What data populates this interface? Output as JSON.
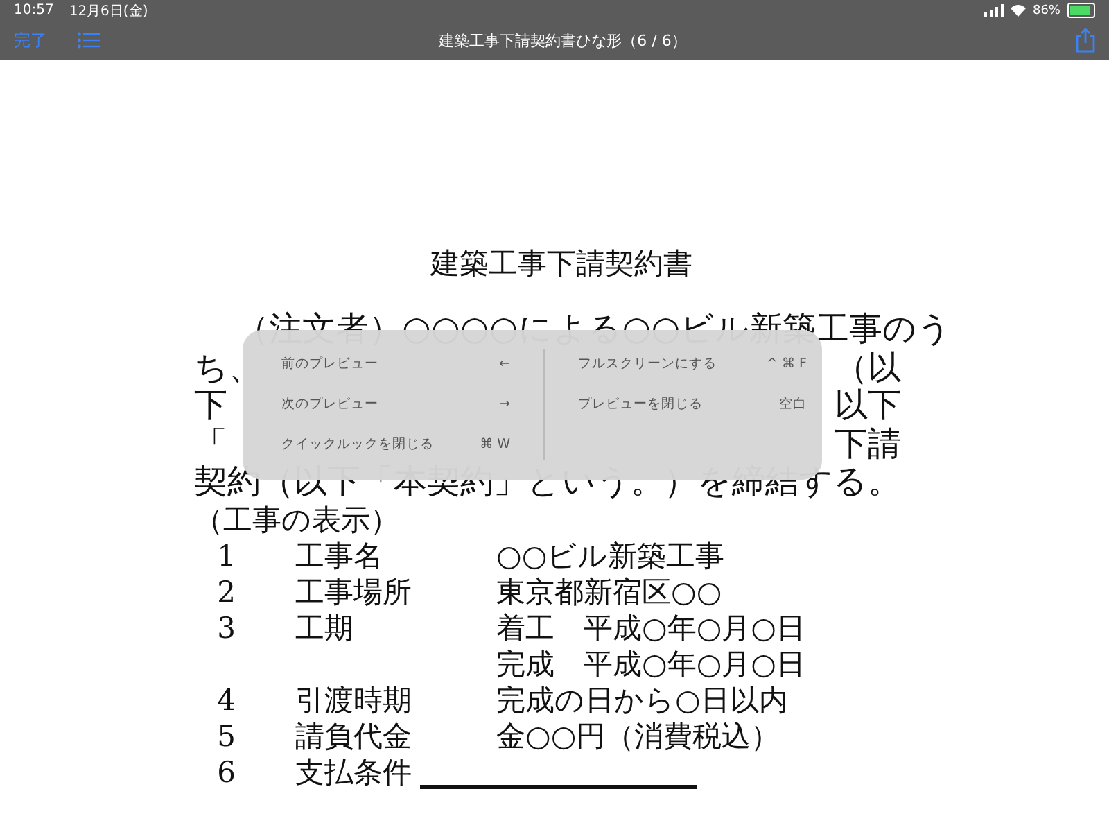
{
  "status_bar": {
    "time": "10:57",
    "date": "12月6日(金)",
    "battery": "86%",
    "level": 0.86
  },
  "nav": {
    "done": "完了",
    "title": "建築工事下請契約書ひな形（6 / 6）"
  },
  "document": {
    "title": "建築工事下請契約書",
    "paragraph_lines": [
      {
        "left": "（注文者）○○○○による○○ビル新築工事のう"
      },
      {
        "left": "ち、",
        "right": "（以"
      },
      {
        "left": "下",
        "right": "以下"
      },
      {
        "left": "「",
        "right": "下請"
      },
      {
        "left": "契約（以下「本契約」という。）を締結する。"
      }
    ],
    "section_heading": "（工事の表示）",
    "items": [
      {
        "number": "1",
        "label": "工事名",
        "values": [
          "○○ビル新築工事"
        ],
        "blank": false
      },
      {
        "number": "2",
        "label": "工事場所",
        "values": [
          "東京都新宿区○○"
        ],
        "blank": false
      },
      {
        "number": "3",
        "label": "工期",
        "values": [
          "着工　平成○年○月○日",
          "完成　平成○年○月○日"
        ],
        "blank": false
      },
      {
        "number": "4",
        "label": "引渡時期",
        "values": [
          "完成の日から○日以内"
        ],
        "blank": false
      },
      {
        "number": "5",
        "label": "請負代金",
        "values": [
          "金○○円（消費税込）"
        ],
        "blank": false
      },
      {
        "number": "6",
        "label": "支払条件",
        "blank": true
      }
    ]
  },
  "shortcuts": {
    "columns": [
      [
        {
          "label": "前のプレビュー",
          "key": "←"
        },
        {
          "label": "次のプレビュー",
          "key": "→"
        },
        {
          "label": "クイックルックを閉じる",
          "key": "⌘ W"
        }
      ],
      [
        {
          "label": "フルスクリーンにする",
          "key": "^ ⌘ F"
        },
        {
          "label": "プレビューを閉じる",
          "key": "空白"
        }
      ]
    ]
  }
}
